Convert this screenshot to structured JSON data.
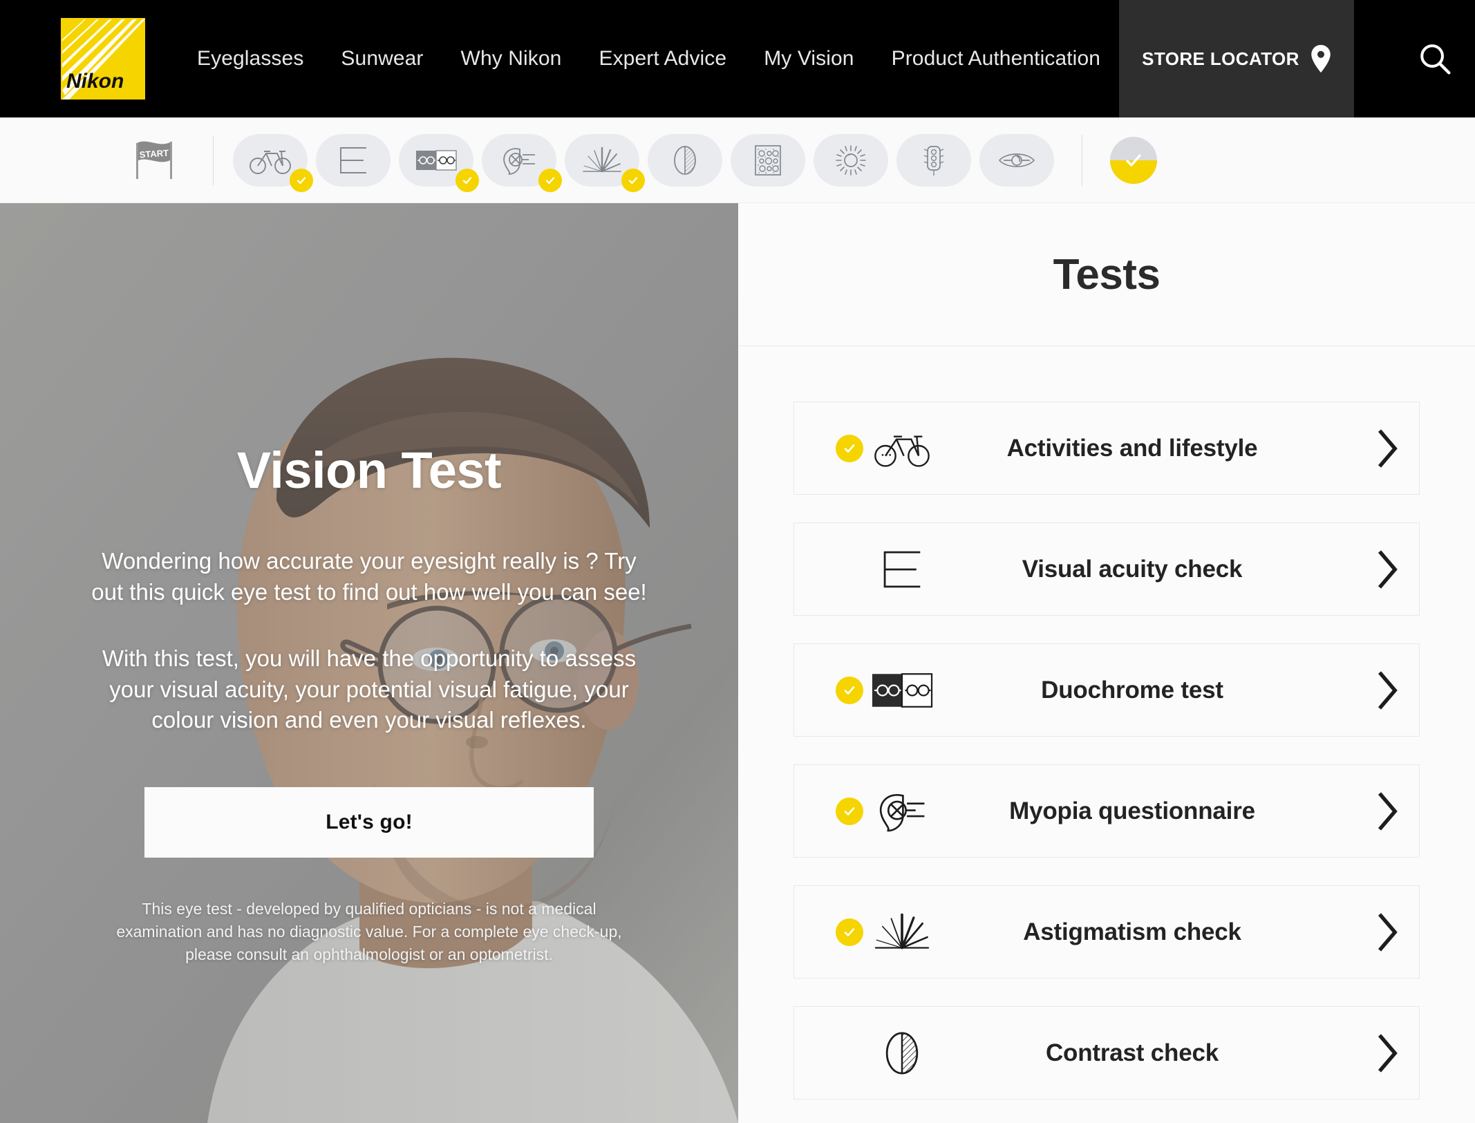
{
  "brand": {
    "name": "Nikon",
    "logo_bg": "#f5d400"
  },
  "accent": {
    "yellow": "#f5d400",
    "dark": "#000000",
    "panel_gray": "#2e2e2e"
  },
  "nav": {
    "links": [
      {
        "label": "Eyeglasses",
        "name": "nav-link-eyeglasses"
      },
      {
        "label": "Sunwear",
        "name": "nav-link-sunwear"
      },
      {
        "label": "Why Nikon",
        "name": "nav-link-why-nikon"
      },
      {
        "label": "Expert Advice",
        "name": "nav-link-expert-advice"
      },
      {
        "label": "My Vision",
        "name": "nav-link-my-vision"
      },
      {
        "label": "Product Authentication",
        "name": "nav-link-product-authentication"
      }
    ],
    "store_locator": "STORE LOCATOR",
    "search_icon": "search-icon",
    "pin_icon": "map-pin-icon"
  },
  "stepbar": {
    "start_label": "START",
    "steps": [
      {
        "icon": "bicycle-icon",
        "completed": true
      },
      {
        "icon": "acuity-chart-icon",
        "completed": false
      },
      {
        "icon": "duochrome-glasses-icon",
        "completed": true
      },
      {
        "icon": "myopia-eye-icon",
        "completed": true
      },
      {
        "icon": "astigmatism-fan-icon",
        "completed": true
      },
      {
        "icon": "contrast-ellipse-icon",
        "completed": false
      },
      {
        "icon": "colour-vision-plate-icon",
        "completed": false
      },
      {
        "icon": "sun-glare-icon",
        "completed": false
      },
      {
        "icon": "traffic-light-icon",
        "completed": false
      },
      {
        "icon": "eye-reflex-icon",
        "completed": false
      }
    ],
    "final_progress": {
      "icon": "check-icon",
      "fill_percent": 50
    }
  },
  "hero": {
    "title": "Vision Test",
    "paragraph_1": "Wondering how accurate your eyesight really is ? Try out this quick eye test to find out how well you can see!",
    "paragraph_2": "With this test, you will have the opportunity to assess your visual acuity, your potential visual fatigue, your colour vision and even your visual reflexes.",
    "cta_label": "Let's go!",
    "disclaimer": "This eye test - developed by qualified opticians - is not a medical examination and has no diagnostic value. For a complete eye check-up, please consult an ophthalmologist or an optometrist."
  },
  "tests": {
    "heading": "Tests",
    "items": [
      {
        "label": "Activities and lifestyle",
        "icon": "bicycle-icon",
        "completed": true
      },
      {
        "label": "Visual acuity check",
        "icon": "acuity-chart-icon",
        "completed": false
      },
      {
        "label": "Duochrome test",
        "icon": "duochrome-glasses-icon",
        "completed": true
      },
      {
        "label": "Myopia questionnaire",
        "icon": "myopia-eye-icon",
        "completed": true
      },
      {
        "label": "Astigmatism check",
        "icon": "astigmatism-fan-icon",
        "completed": true
      },
      {
        "label": "Contrast check",
        "icon": "contrast-ellipse-icon",
        "completed": false
      }
    ]
  }
}
